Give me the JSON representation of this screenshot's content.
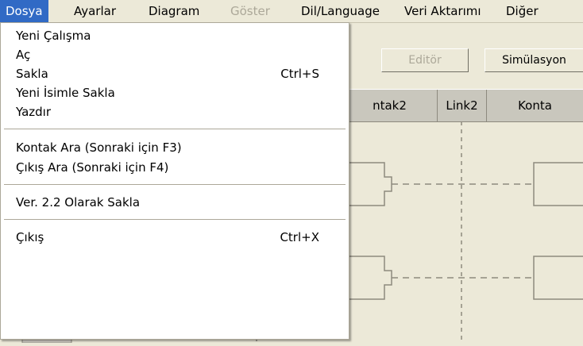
{
  "menubar": {
    "items": [
      {
        "label": "Dosya"
      },
      {
        "label": "Ayarlar"
      },
      {
        "label": "Diagram"
      },
      {
        "label": "Göster"
      },
      {
        "label": "Dil/Language"
      },
      {
        "label": "Veri Aktarımı"
      },
      {
        "label": "Diğer"
      }
    ]
  },
  "toolbar": {
    "editor_label": "Editör",
    "simulation_label": "Simülasyon"
  },
  "header": {
    "kontak2": "ntak2",
    "link2": "Link2",
    "kontak3": "Konta"
  },
  "dropdown": {
    "items": [
      {
        "label": "Yeni Çalışma",
        "shortcut": ""
      },
      {
        "label": "Aç",
        "shortcut": ""
      },
      {
        "label": "Sakla",
        "shortcut": "Ctrl+S"
      },
      {
        "label": "Yeni İsimle Sakla",
        "shortcut": ""
      },
      {
        "label": "Yazdır",
        "shortcut": ""
      },
      {
        "label": "Kontak Ara   (Sonraki için F3)",
        "shortcut": ""
      },
      {
        "label": "Çıkış Ara   (Sonraki için F4)",
        "shortcut": ""
      },
      {
        "label": "Ver. 2.2 Olarak Sakla",
        "shortcut": ""
      },
      {
        "label": "Çıkış",
        "shortcut": "Ctrl+X"
      }
    ]
  },
  "colors": {
    "menu_highlight": "#316ac5",
    "background": "#ece9d8",
    "disabled_text": "#aca899"
  }
}
